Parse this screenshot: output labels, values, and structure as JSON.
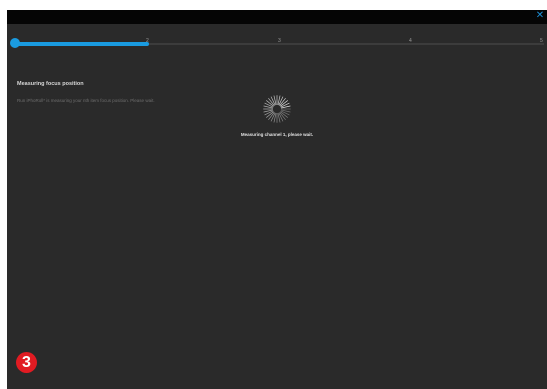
{
  "window": {
    "close_glyph": "✕"
  },
  "progress": {
    "steps": [
      "2",
      "3",
      "4",
      "5"
    ],
    "current_fraction": 0.25
  },
  "main": {
    "heading": "Measuring focus position",
    "description": "Run iPhoRoll* is measuring your nth item focus position. Please wait.",
    "status": "Measuring channel 1, please wait."
  },
  "badge": {
    "label": "3"
  },
  "colors": {
    "accent": "#1a9be0",
    "background": "#2a2a2a",
    "titlebar": "#050505",
    "badge": "#e11b22"
  },
  "icons": {
    "close": "close-icon",
    "spinner": "spinner-icon"
  }
}
